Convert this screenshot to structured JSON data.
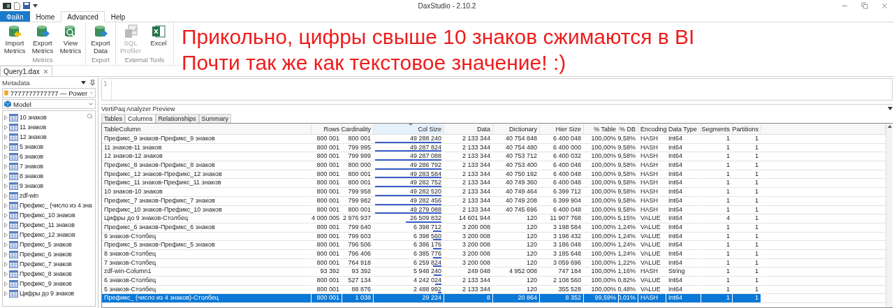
{
  "window": {
    "title": "DaxStudio - 2.10.2"
  },
  "menu_tabs": [
    {
      "label": "Файл",
      "kind": "file",
      "selected": false
    },
    {
      "label": "Home",
      "kind": "tab",
      "selected": false
    },
    {
      "label": "Advanced",
      "kind": "tab",
      "selected": true
    },
    {
      "label": "Help",
      "kind": "tab",
      "selected": false
    }
  ],
  "ribbon": {
    "groups": [
      {
        "label": "Metrics",
        "buttons": [
          {
            "label": "Import Metrics",
            "kind": "import",
            "disabled": false
          },
          {
            "label": "Export Metrics",
            "kind": "export",
            "disabled": false
          },
          {
            "label": "View Metrics",
            "kind": "view",
            "disabled": false
          }
        ]
      },
      {
        "label": "Export",
        "buttons": [
          {
            "label": "Export Data",
            "kind": "export",
            "disabled": false
          }
        ]
      },
      {
        "label": "External Tools",
        "buttons": [
          {
            "label": "SQL Profiler",
            "kind": "profiler",
            "disabled": true
          },
          {
            "label": "Excel",
            "kind": "excel",
            "disabled": false
          }
        ]
      }
    ]
  },
  "annotation": {
    "lines": [
      "Прикольно, цифры свыше 10 знаков сжимаются в BI",
      "Почти так же как текстовое значение! :)"
    ]
  },
  "document_tabs": [
    {
      "label": "Query1.dax",
      "selected": true
    }
  ],
  "metadata_panel": {
    "title": "Metadata",
    "connection": "7777777777777 — Power",
    "model": "Model",
    "tables": [
      {
        "label": "10 знаков"
      },
      {
        "label": "11 знаков"
      },
      {
        "label": "12 знаков"
      },
      {
        "label": "5 знаков"
      },
      {
        "label": "6 знаков"
      },
      {
        "label": "7 знаков"
      },
      {
        "label": "8 знаков"
      },
      {
        "label": "9 знаков"
      },
      {
        "label": "zdf-win"
      },
      {
        "label": "Префикс_ (число из 4 зна"
      },
      {
        "label": "Префикс_10 знаков"
      },
      {
        "label": "Префикс_11 знаков"
      },
      {
        "label": "Префикс_12 знаков"
      },
      {
        "label": "Префикс_5 знаков"
      },
      {
        "label": "Префикс_6 знаков"
      },
      {
        "label": "Префикс_7 знаков"
      },
      {
        "label": "Префикс_8 знаков"
      },
      {
        "label": "Префикс_9 знаков"
      },
      {
        "label": "Цифры до 9 знаков"
      }
    ]
  },
  "editor": {
    "line_numbers": [
      "1"
    ]
  },
  "vertipaq": {
    "title": "VertiPaq Analyzer Preview",
    "tabs": [
      {
        "label": "Tables",
        "selected": false
      },
      {
        "label": "Columns",
        "selected": true
      },
      {
        "label": "Relationships",
        "selected": false
      },
      {
        "label": "Summary",
        "selected": false
      }
    ],
    "columns": [
      {
        "label": "TableColumn",
        "sorted": false
      },
      {
        "label": "Rows",
        "sorted": false
      },
      {
        "label": "Cardinality",
        "sorted": false
      },
      {
        "label": "Col Size",
        "sorted": true
      },
      {
        "label": "Data",
        "sorted": false
      },
      {
        "label": "Dictionary",
        "sorted": false
      },
      {
        "label": "Hier Size",
        "sorted": false
      },
      {
        "label": "% Table",
        "sorted": false
      },
      {
        "label": "% DB",
        "sorted": false
      },
      {
        "label": "Encoding",
        "sorted": false
      },
      {
        "label": "Data Type",
        "sorted": false
      },
      {
        "label": "Segments",
        "sorted": false
      },
      {
        "label": "Partitions",
        "sorted": false
      }
    ],
    "rows": [
      {
        "cells": [
          "Префикс_9 знаков-Префикс_9 знаков",
          "800 001",
          "800 001",
          "49 288 240",
          "2 133 344",
          "40 754 848",
          "6 400 048",
          "100,00%",
          "9,58%",
          "HASH",
          "Int64",
          "1",
          "1"
        ],
        "level": 1.0,
        "selected": false
      },
      {
        "cells": [
          "11 знаков-11 знаков",
          "800 001",
          "799 995",
          "49 287 824",
          "2 133 344",
          "40 754 480",
          "6 400 000",
          "100,00%",
          "9,58%",
          "HASH",
          "Int64",
          "1",
          "1"
        ],
        "level": 1.0,
        "selected": false
      },
      {
        "cells": [
          "12 знаков-12 знаков",
          "800 001",
          "799 999",
          "49 287 088",
          "2 133 344",
          "40 753 712",
          "6 400 032",
          "100,00%",
          "9,58%",
          "HASH",
          "Int64",
          "1",
          "1"
        ],
        "level": 1.0,
        "selected": false
      },
      {
        "cells": [
          "Префикс_8 знаков-Префикс_8 знаков",
          "800 001",
          "800 000",
          "49 286 792",
          "2 133 344",
          "40 753 400",
          "6 400 048",
          "100,00%",
          "9,58%",
          "HASH",
          "Int64",
          "1",
          "1"
        ],
        "level": 1.0,
        "selected": false
      },
      {
        "cells": [
          "Префикс_12 знаков-Префикс_12 знаков",
          "800 001",
          "800 001",
          "49 283 584",
          "2 133 344",
          "40 750 192",
          "6 400 048",
          "100,00%",
          "9,58%",
          "HASH",
          "Int64",
          "1",
          "1"
        ],
        "level": 1.0,
        "selected": false
      },
      {
        "cells": [
          "Префикс_11 знаков-Префикс_11 знаков",
          "800 001",
          "800 001",
          "49 282 752",
          "2 133 344",
          "40 749 360",
          "6 400 048",
          "100,00%",
          "9,58%",
          "HASH",
          "Int64",
          "1",
          "1"
        ],
        "level": 1.0,
        "selected": false
      },
      {
        "cells": [
          "10 знаков-10 знаков",
          "800 001",
          "799 958",
          "49 282 520",
          "2 133 344",
          "40 749 464",
          "6 399 712",
          "100,00%",
          "9,58%",
          "HASH",
          "Int64",
          "1",
          "1"
        ],
        "level": 1.0,
        "selected": false
      },
      {
        "cells": [
          "Префикс_7 знаков-Префикс_7 знаков",
          "800 001",
          "799 982",
          "49 282 456",
          "2 133 344",
          "40 749 208",
          "6 399 904",
          "100,00%",
          "9,58%",
          "HASH",
          "Int64",
          "1",
          "1"
        ],
        "level": 1.0,
        "selected": false
      },
      {
        "cells": [
          "Префикс_10 знаков-Префикс_10 знаков",
          "800 001",
          "800 001",
          "49 279 088",
          "2 133 344",
          "40 745 696",
          "6 400 048",
          "100,00%",
          "9,58%",
          "HASH",
          "Int64",
          "1",
          "1"
        ],
        "level": 1.0,
        "selected": false
      },
      {
        "cells": [
          "Цифры до 9 знаков-Столбец",
          "4 000 005",
          "2 976 937",
          "26 509 832",
          "14 601 944",
          "120",
          "11 907 768",
          "100,00%",
          "5,15%",
          "VALUE",
          "Int64",
          "4",
          "1"
        ],
        "level": 0.54,
        "selected": false
      },
      {
        "cells": [
          "Префикс_6 знаков-Префикс_6 знаков",
          "800 001",
          "799 640",
          "6 398 712",
          "3 200 008",
          "120",
          "3 198 584",
          "100,00%",
          "1,24%",
          "VALUE",
          "Int64",
          "1",
          "1"
        ],
        "level": 0.13,
        "selected": false
      },
      {
        "cells": [
          "9 знаков-Столбец",
          "800 001",
          "799 603",
          "6 398 560",
          "3 200 008",
          "120",
          "3 198 432",
          "100,00%",
          "1,24%",
          "VALUE",
          "Int64",
          "1",
          "1"
        ],
        "level": 0.13,
        "selected": false
      },
      {
        "cells": [
          "Префикс_5 знаков-Префикс_5 знаков",
          "800 001",
          "796 506",
          "6 386 176",
          "3 200 008",
          "120",
          "3 186 048",
          "100,00%",
          "1,24%",
          "VALUE",
          "Int64",
          "1",
          "1"
        ],
        "level": 0.13,
        "selected": false
      },
      {
        "cells": [
          "8 знаков-Столбец",
          "800 001",
          "796 406",
          "6 385 776",
          "3 200 008",
          "120",
          "3 185 648",
          "100,00%",
          "1,24%",
          "VALUE",
          "Int64",
          "1",
          "1"
        ],
        "level": 0.13,
        "selected": false
      },
      {
        "cells": [
          "7 знаков-Столбец",
          "800 001",
          "764 918",
          "6 259 824",
          "3 200 008",
          "120",
          "3 059 696",
          "100,00%",
          "1,22%",
          "VALUE",
          "Int64",
          "1",
          "1"
        ],
        "level": 0.13,
        "selected": false
      },
      {
        "cells": [
          "zdf-win-Column1",
          "93 392",
          "93 392",
          "5 948 240",
          "249 048",
          "4 952 008",
          "747 184",
          "100,00%",
          "1,16%",
          "HASH",
          "String",
          "1",
          "1"
        ],
        "level": 0.12,
        "selected": false
      },
      {
        "cells": [
          "6 знаков-Столбец",
          "800 001",
          "527 134",
          "4 242 024",
          "2 133 344",
          "120",
          "2 108 560",
          "100,00%",
          "0,82%",
          "VALUE",
          "Int64",
          "1",
          "1"
        ],
        "level": 0.09,
        "selected": false
      },
      {
        "cells": [
          "5 знаков-Столбец",
          "800 001",
          "88 876",
          "2 488 992",
          "2 133 344",
          "120",
          "355 528",
          "100,00%",
          "0,48%",
          "VALUE",
          "Int64",
          "1",
          "1"
        ],
        "level": 0.05,
        "selected": false
      },
      {
        "cells": [
          "Префикс_ (число из 4 знаков)-Столбец",
          "800 001",
          "1 038",
          "29 224",
          "8",
          "20 864",
          "8 352",
          "99,59%",
          "0,01%",
          "HASH",
          "Int64",
          "1",
          "1"
        ],
        "level": 0.02,
        "selected": true
      }
    ]
  }
}
